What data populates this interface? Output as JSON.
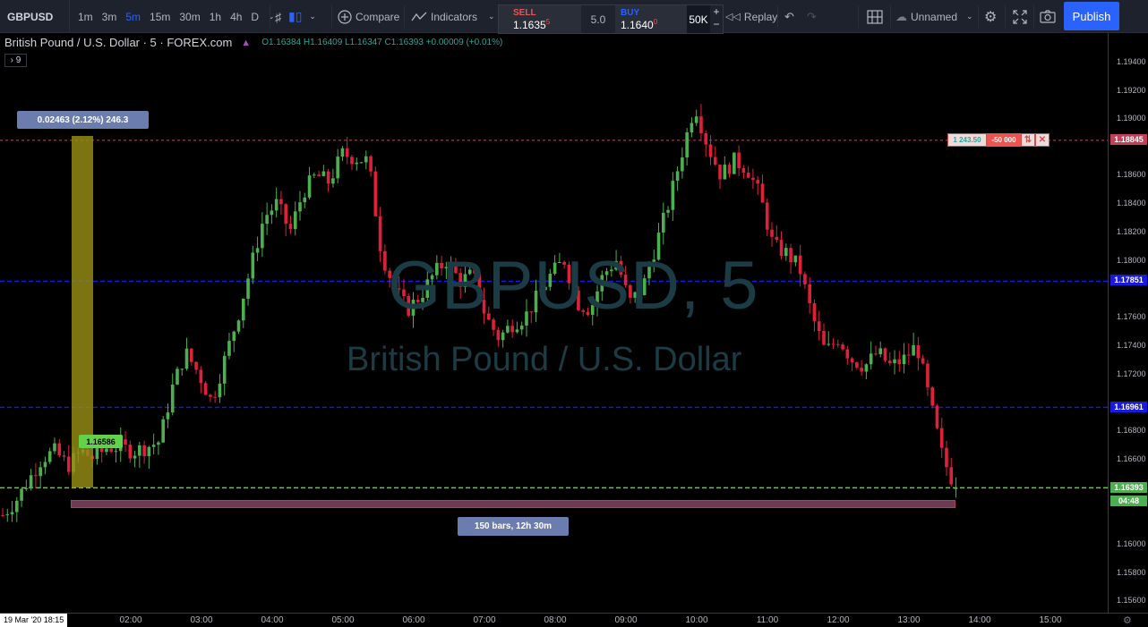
{
  "toolbar": {
    "symbol": "GBPUSD",
    "intervals": [
      "1m",
      "3m",
      "5m",
      "15m",
      "30m",
      "1h",
      "4h",
      "D"
    ],
    "active_interval": "5m",
    "compare_label": "Compare",
    "indicators_label": "Indicators",
    "replay_label": "Replay",
    "layout_name": "Unnamed",
    "publish_label": "Publish"
  },
  "trade_panel": {
    "sell_label": "SELL",
    "sell_price": "1.1635",
    "sell_sup": "5",
    "spread": "5.0",
    "buy_label": "BUY",
    "buy_price": "1.1640",
    "buy_sup": "0",
    "quantity": "50K",
    "plus": "+",
    "minus": "−"
  },
  "legend": {
    "title": "British Pound / U.S. Dollar · 5 · FOREX.com",
    "ohlc": "O1.16384 H1.16409 L1.16347 C1.16393 +0.00009 (+0.01%)",
    "studies_count": "› 9"
  },
  "watermark": {
    "symbol_line": "GBPUSD, 5",
    "name_line": "British Pound / U.S. Dollar"
  },
  "price_axis": {
    "ticks": [
      "1.19400",
      "1.19200",
      "1.19000",
      "1.18600",
      "1.18400",
      "1.18200",
      "1.18000",
      "1.17600",
      "1.17400",
      "1.17200",
      "1.16800",
      "1.16600",
      "1.16000",
      "1.15800",
      "1.15600"
    ],
    "labels": {
      "top_line": "1.18845",
      "line_1": "1.17851",
      "line_2": "1.16961",
      "current": "1.16393",
      "countdown": "04:48"
    }
  },
  "time_axis": {
    "cursor_label": "19 Mar '20   18:15",
    "ticks": [
      "02:00",
      "03:00",
      "04:00",
      "05:00",
      "06:00",
      "07:00",
      "08:00",
      "09:00",
      "10:00",
      "11:00",
      "12:00",
      "13:00",
      "14:00",
      "15:00"
    ]
  },
  "drawings": {
    "measure_label": "0.02463 (2.12%) 246.3",
    "range_label": "150 bars, 12h 30m",
    "price_tag": "1.16586"
  },
  "order": {
    "pnl": "1 243.50",
    "qty": "-50 000",
    "reverse": "⇅",
    "close": "✕"
  },
  "colors": {
    "up": "#4caf50",
    "down": "#e0203a",
    "hline": "#1a1adc",
    "current_line": "#60d040",
    "order_line": "#b0505c",
    "accent": "#2962ff"
  },
  "chart_data": {
    "type": "candlestick",
    "title": "British Pound / U.S. Dollar · 5 · FOREX.com",
    "interval": "5m",
    "ylim": [
      1.155,
      1.196
    ],
    "x": [
      "02:00",
      "03:00",
      "04:00",
      "05:00",
      "06:00",
      "07:00",
      "08:00",
      "09:00",
      "10:00",
      "11:00",
      "12:00",
      "13:00",
      "14:00",
      "15:00"
    ],
    "horizontal_lines": [
      1.18845,
      1.17851,
      1.16961,
      1.16393
    ],
    "last": {
      "open": 1.16384,
      "high": 1.16409,
      "low": 1.16347,
      "close": 1.16393
    },
    "close_path": [
      1.162,
      1.163,
      1.1645,
      1.166,
      1.1665,
      1.1655,
      1.1665,
      1.166,
      1.1668,
      1.1668,
      1.1665,
      1.1668,
      1.1672,
      1.171,
      1.1735,
      1.172,
      1.17,
      1.173,
      1.176,
      1.1795,
      1.183,
      1.184,
      1.182,
      1.1848,
      1.186,
      1.1855,
      1.1875,
      1.1872,
      1.187,
      1.1805,
      1.178,
      1.1765,
      1.1775,
      1.179,
      1.18,
      1.1785,
      1.179,
      1.176,
      1.1745,
      1.1755,
      1.176,
      1.1775,
      1.179,
      1.18,
      1.177,
      1.1765,
      1.179,
      1.18,
      1.177,
      1.178,
      1.181,
      1.184,
      1.1875,
      1.191,
      1.188,
      1.186,
      1.187,
      1.1865,
      1.1845,
      1.181,
      1.1805,
      1.1795,
      1.176,
      1.1735,
      1.1745,
      1.173,
      1.1725,
      1.1735,
      1.1725,
      1.173,
      1.174,
      1.17,
      1.166,
      1.1639
    ]
  }
}
